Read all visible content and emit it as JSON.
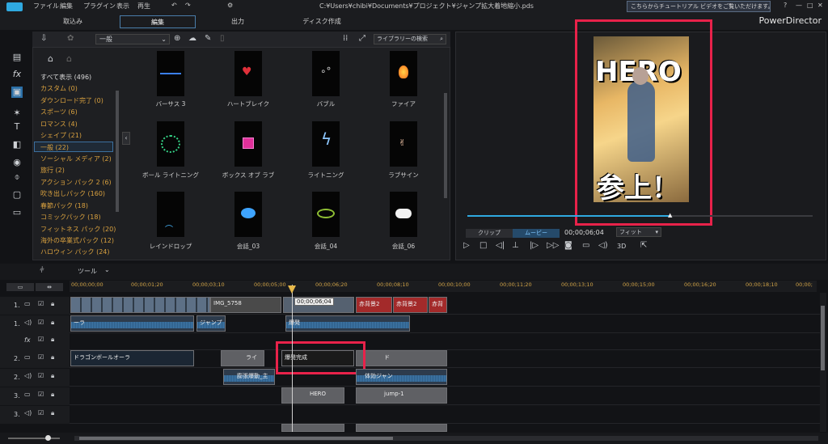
{
  "menu": [
    "ファイル",
    "編集",
    "プラグイン",
    "表示",
    "再生"
  ],
  "path": "C:¥Users¥chibi¥Documents¥プロジェクト¥ジャンプ拡大着地縮小.pds",
  "tutorial": "こちらからチュートリアル ビデオをご覧いただけます。",
  "app": "PowerDirector",
  "mode_tabs": [
    "取込み",
    "編集",
    "出力",
    "ディスク作成"
  ],
  "lib": {
    "dropdown": "一般",
    "search": "ライブラリーの検索"
  },
  "categories": [
    "すべて表示 (496)",
    "カスタム (0)",
    "ダウンロード完了 (0)",
    "スポーツ (6)",
    "ロマンス (4)",
    "シェイプ (21)",
    "一般 (22)",
    "ソーシャル メディア (2)",
    "旅行 (2)",
    "アクション パック 2 (6)",
    "吹き出しパック (160)",
    "春節パック (18)",
    "コミックパック (18)",
    "フィットネス パック (20)",
    "海外の卒業式パック (12)",
    "ハロウィン パック (24)"
  ],
  "thumbs": [
    "バーサス 3",
    "ハートブレイク",
    "バブル",
    "ファイア",
    "ボール ライトニング",
    "ボックス オブ ラブ",
    "ライトニング",
    "ラブサイン",
    "レインドロップ",
    "会話_03",
    "会話_04",
    "会話_06"
  ],
  "preview": {
    "clip": "クリップ",
    "movie": "ムービー",
    "time": "00;00;06;04",
    "fit": "フィット",
    "threeD": "3D",
    "hero": "HERO",
    "bottom": "参上！"
  },
  "tools": {
    "tool": "ツール"
  },
  "ruler": [
    "00;00;00;00",
    "00;00;01;20",
    "00;00;03;10",
    "00;00;05;00",
    "00;00;06;20",
    "00;00;08;10",
    "00;00;10;00",
    "00;00;11;20",
    "00;00;13;10",
    "00;00;15;00",
    "00;00;16;20",
    "00;00;18;10",
    "00;00;"
  ],
  "playhead": "00;00;06;04",
  "tracks": [
    "1.",
    "1.",
    "fx",
    "2.",
    "2.",
    "3.",
    "3."
  ],
  "clips": {
    "v1a": "IMG_5758",
    "v1b": "赤背景2",
    "v1c": "赤背景2",
    "v1d": "赤背",
    "a1a": "ーラ",
    "a1b": "ジャンプ",
    "a1c": "爆発",
    "v2a": "ドラゴンボールオーラ",
    "v2b": "ライ",
    "v2c": "爆発完成",
    "v2d": "ド",
    "a2a": "膨張爆動_主",
    "a2b": "体効ジャン",
    "v3a": "HERO",
    "v3b": "jump-1"
  }
}
